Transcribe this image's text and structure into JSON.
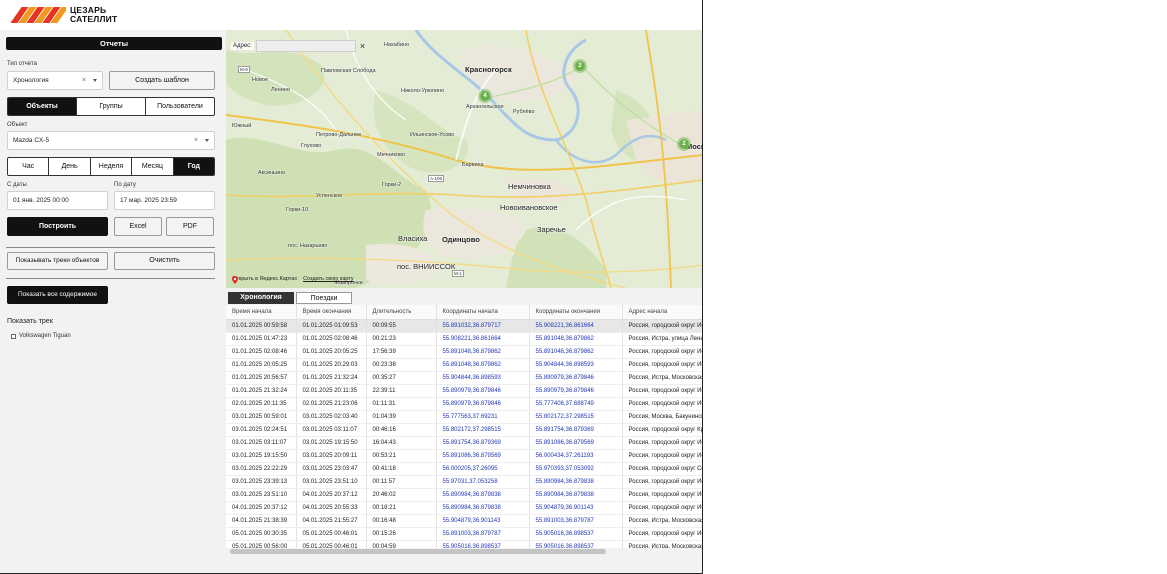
{
  "brand": {
    "line1": "ЦЕЗАРЬ",
    "line2": "САТЕЛЛИТ",
    "stripe_colors": [
      "#e63323",
      "#f29a1f",
      "#e63323",
      "#f29a1f",
      "#e63323",
      "#f29a1f"
    ]
  },
  "sidebar": {
    "title": "Отчеты",
    "report_type_label": "Тип отчета",
    "report_type_value": "Хронология",
    "create_template": "Создать шаблон",
    "entity_tabs": [
      "Объекты",
      "Группы",
      "Пользователи"
    ],
    "entity_active": 0,
    "object_label": "Объект",
    "object_value": "Mazda CX-5",
    "period_tabs": [
      "Час",
      "День",
      "Неделя",
      "Месяц",
      "Год"
    ],
    "period_active": 4,
    "from_label": "С даты",
    "from_value": "01 янв. 2025 00:00",
    "to_label": "По дату",
    "to_value": "17 мар. 2025 23:59",
    "build": "Построить",
    "excel": "Excel",
    "pdf": "PDF",
    "show_tracks": "Показывать треки объектов",
    "clear": "Очистить",
    "show_all": "Показать все содержимое",
    "show_track_label": "Показать трек",
    "track_items": [
      "Volkswagen Tiguan"
    ]
  },
  "map": {
    "address_label": "Адрес:",
    "clear_icon": "close-icon",
    "open_yandex": "Открыть в Яндекс.Картах",
    "create_map": "Создать свою карту",
    "labels": {
      "nakhabino": "Нахабино",
      "krasnogorsk": "Красногорск",
      "pavlovskaya": "Павловская Слобода",
      "novoe": "Новое",
      "lenino": "Ленино",
      "nikolo": "Николо-Урюпино",
      "arkhangelskoe": "Архангельское",
      "ilyinskoe": "Ильинское-Усово",
      "rublevo": "Рублёво",
      "yuzhny": "Южный",
      "petrovo": "Петрово-Дальнее",
      "glukhovo": "Глухово",
      "mechnikovo": "Мечниково",
      "barvikha": "Барвиха",
      "aksinino": "Аксиньино",
      "gorki2": "Горки-2",
      "nemchinovka": "Немчиновка",
      "uspenskoe": "Успенское",
      "novoivanovskoe": "Новоивановское",
      "gorki10": "Горки-10",
      "zarechye": "Заречье",
      "vlasikha": "Власиха",
      "odintsovo": "Одинцово",
      "nazarevo": "пос. Назарьево",
      "vniissok": "пос. ВНИИССОК",
      "zhavoronki": "Жаворонки",
      "moscow": "Моск",
      "r106": "А-106",
      "m9": "М-9",
      "m1": "М-1"
    },
    "clusters": [
      {
        "label": "2"
      },
      {
        "label": "4"
      },
      {
        "label": "2"
      }
    ]
  },
  "tabs": [
    "Хронология",
    "Поездки"
  ],
  "table": {
    "headers": [
      "Время начала",
      "Время окончания",
      "Длительность",
      "Координаты начала",
      "Координаты окончания",
      "Адрес начала"
    ],
    "rows": [
      [
        "01.01.2025 00:59:58",
        "01.01.2025 01:09:53",
        "00:09:55",
        "55.891032,36.879717",
        "55.908221,36.861664",
        "Россия, городской округ Ис"
      ],
      [
        "01.01.2025 01:47:23",
        "01.01.2025 02:08:46",
        "00:21:23",
        "55.908221,36.861664",
        "55.891048,36.879862",
        "Россия, Истра, улица Лени"
      ],
      [
        "01.01.2025 02:08:46",
        "01.01.2025 20:05:25",
        "17:56:39",
        "55.891048,36.879862",
        "55.891048,36.879862",
        "Россия, городской округ Ис"
      ],
      [
        "01.01.2025 20:05:25",
        "01.01.2025 20:29:03",
        "00:23:38",
        "55.891048,36.879862",
        "55.904844,36.898593",
        "Россия, городской округ Ис"
      ],
      [
        "01.01.2025 20:56:57",
        "01.01.2025 21:32:24",
        "00:35:27",
        "55.904844,36.898593",
        "55.890979,36.879846",
        "Россия, Истра, Московская"
      ],
      [
        "01.01.2025 21:32:24",
        "02.01.2025 20:11:35",
        "22:39:11",
        "55.890979,36.879846",
        "55.890979,36.879846",
        "Россия, городской округ Ис"
      ],
      [
        "02.01.2025 20:11:35",
        "02.01.2025 21:23:06",
        "01:11:31",
        "55.890979,36.879846",
        "55.777408,37.688749",
        "Россия, городской округ Ис"
      ],
      [
        "03.01.2025 00:59:01",
        "03.01.2025 02:03:40",
        "01:04:39",
        "55.777563,37.69231",
        "55.802172,37.298515",
        "Россия, Москва, Бакунинск"
      ],
      [
        "03.01.2025 02:24:51",
        "03.01.2025 03:11:07",
        "00:46:16",
        "55.802172,37.298515",
        "55.891754,36.879369",
        "Россия, городской округ Кр"
      ],
      [
        "03.01.2025 03:11:07",
        "03.01.2025 19:15:50",
        "16:04:43",
        "55.891754,36.879369",
        "55.891086,36.879569",
        "Россия, городской округ Ис"
      ],
      [
        "03.01.2025 19:15:50",
        "03.01.2025 20:09:11",
        "00:53:21",
        "55.891086,36.879569",
        "56.000434,37.261193",
        "Россия, городской округ Ис"
      ],
      [
        "03.01.2025 22:22:29",
        "03.01.2025 23:03:47",
        "00:41:18",
        "56.000205,37.26095",
        "55.970393,37.053092",
        "Россия, городской округ Со"
      ],
      [
        "03.01.2025 23:39:13",
        "03.01.2025 23:51:10",
        "00:11:57",
        "55.97031,37.053258",
        "55.890984,36.879838",
        "Россия, городской округ Ис"
      ],
      [
        "03.01.2025 23:51:10",
        "04.01.2025 20:37:12",
        "20:46:02",
        "55.890984,36.879838",
        "55.890984,36.879838",
        "Россия, городской округ Ис"
      ],
      [
        "04.01.2025 20:37:12",
        "04.01.2025 20:55:33",
        "00:18:21",
        "55.890984,36.879838",
        "55.904879,36.901143",
        "Россия, городской округ Ис"
      ],
      [
        "04.01.2025 21:38:39",
        "04.01.2025 21:55:27",
        "00:16:48",
        "55.904879,36.901143",
        "55.891003,36.879787",
        "Россия, Истра, Московская"
      ],
      [
        "05.01.2025 00:30:35",
        "05.01.2025 00:46:01",
        "00:15:26",
        "55.891003,36.879787",
        "55.905016,36.898537",
        "Россия, городской округ Ис"
      ],
      [
        "05.01.2025 00:56:00",
        "05.01.2025 00:46:01",
        "00:04:59",
        "55.905016,36.898537",
        "55.905016,36.898537",
        "Россия, Истра, Московская"
      ]
    ]
  }
}
